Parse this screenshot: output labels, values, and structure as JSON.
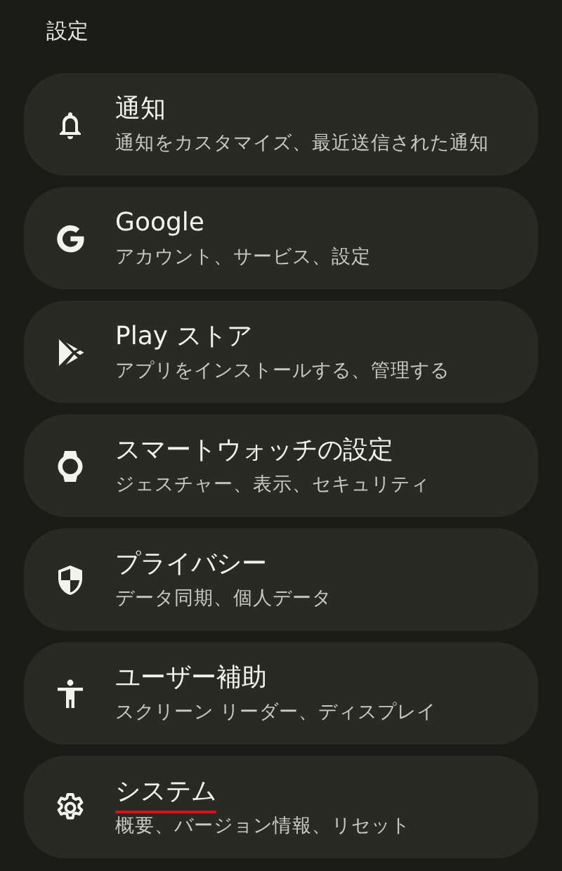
{
  "header": {
    "title": "設定"
  },
  "items": [
    {
      "kind": "bell",
      "title": "通知",
      "subtitle": "通知をカスタマイズ、最近送信された通知",
      "underlined": false
    },
    {
      "kind": "g-letter",
      "title": "Google",
      "subtitle": "アカウント、サービス、設定",
      "underlined": false
    },
    {
      "kind": "play",
      "title": "Play ストア",
      "subtitle": "アプリをインストールする、管理する",
      "underlined": false
    },
    {
      "kind": "watch",
      "title": "スマートウォッチの設定",
      "subtitle": "ジェスチャー、表示、セキュリティ",
      "underlined": false
    },
    {
      "kind": "shield",
      "title": "プライバシー",
      "subtitle": "データ同期、個人データ",
      "underlined": false
    },
    {
      "kind": "person",
      "title": "ユーザー補助",
      "subtitle": "スクリーン リーダー、ディスプレイ",
      "underlined": false
    },
    {
      "kind": "gear",
      "title": "システム",
      "subtitle": "概要、バージョン情報、リセット",
      "underlined": true
    }
  ]
}
